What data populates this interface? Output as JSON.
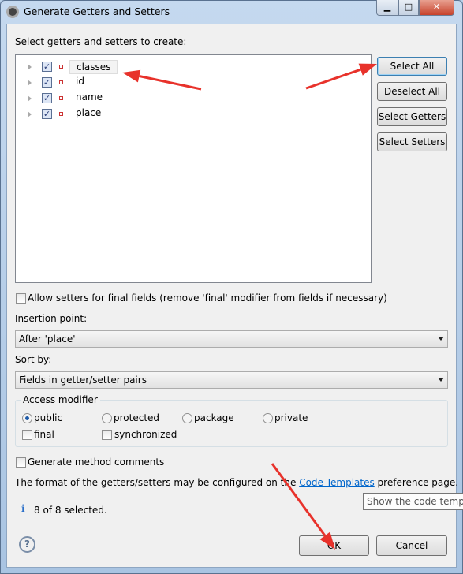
{
  "window": {
    "title": "Generate Getters and Setters",
    "icon": "eclipse-icon",
    "controls": [
      "minimize-icon",
      "maximize-icon",
      "close-icon"
    ]
  },
  "main": {
    "tree_label": "Select getters and setters to create:",
    "fields": [
      {
        "name": "classes",
        "checked": true
      },
      {
        "name": "id",
        "checked": true
      },
      {
        "name": "name",
        "checked": true
      },
      {
        "name": "place",
        "checked": true
      }
    ],
    "buttons": {
      "select_all": "Select All",
      "deselect_all": "Deselect All",
      "select_getters": "Select Getters",
      "select_setters": "Select Setters"
    },
    "allow_final": {
      "label": "Allow setters for final fields (remove 'final' modifier from fields if necessary)",
      "checked": false
    },
    "insertion_point": {
      "label": "Insertion point:",
      "value": "After 'place'"
    },
    "sort_by": {
      "label": "Sort by:",
      "value": "Fields in getter/setter pairs"
    },
    "access_modifier": {
      "label": "Access modifier",
      "options": [
        "public",
        "protected",
        "package",
        "private"
      ],
      "selected": "public",
      "final_label": "final",
      "final_checked": false,
      "synchronized_label": "synchronized",
      "synchronized_checked": false
    },
    "generate_comments": {
      "label": "Generate method comments",
      "checked": false
    },
    "info_pre": "The format of the getters/setters may be configured on the ",
    "info_link": "Code Templates",
    "info_post": " preference page.",
    "tooltip": "Show the code templ",
    "status": "8 of 8 selected.",
    "ok": "OK",
    "cancel": "Cancel"
  },
  "annotations": {
    "arrow_color": "#e8322b"
  }
}
